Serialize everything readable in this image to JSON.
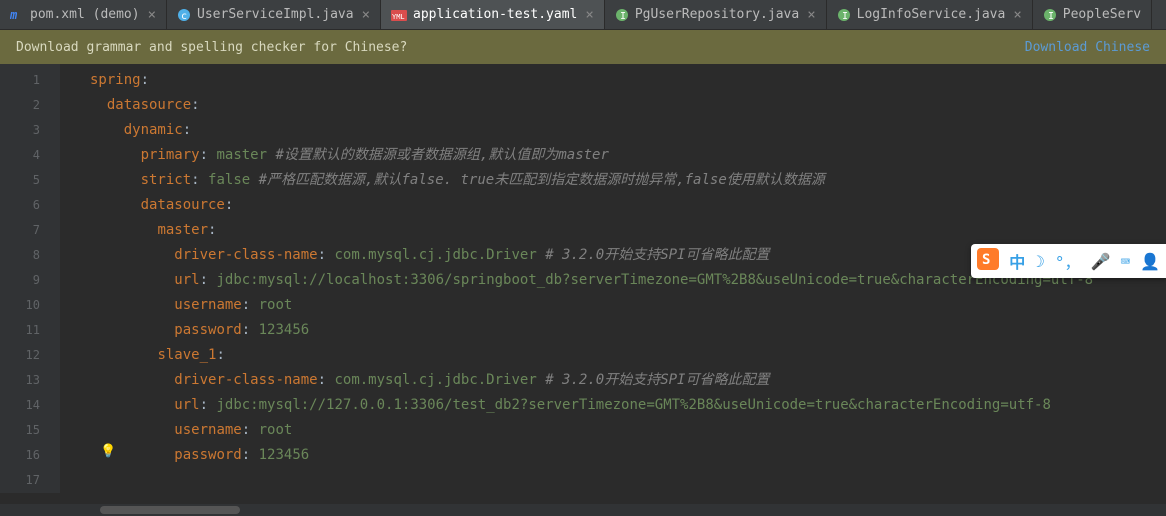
{
  "tabs": [
    {
      "label": "pom.xml (demo)",
      "icon": "maven-icon",
      "iconColor": "#4285f4"
    },
    {
      "label": "UserServiceImpl.java",
      "icon": "java-class-icon",
      "iconColor": "#4fb0e8"
    },
    {
      "label": "application-test.yaml",
      "icon": "yaml-icon",
      "iconColor": "#d94d4d",
      "active": true
    },
    {
      "label": "PgUserRepository.java",
      "icon": "java-interface-icon",
      "iconColor": "#6bb36b"
    },
    {
      "label": "LogInfoService.java",
      "icon": "java-interface-icon",
      "iconColor": "#6bb36b"
    },
    {
      "label": "PeopleServ",
      "icon": "java-interface-icon",
      "iconColor": "#6bb36b"
    }
  ],
  "banner": {
    "message": "Download grammar and spelling checker for Chinese?",
    "action": "Download Chinese"
  },
  "gutter": {
    "start": 1,
    "end": 17
  },
  "code": {
    "lines": [
      {
        "indent": 0,
        "key": "spring",
        "val": "",
        "comment": ""
      },
      {
        "indent": 1,
        "key": "datasource",
        "val": "",
        "comment": ""
      },
      {
        "indent": 2,
        "key": "dynamic",
        "val": "",
        "comment": ""
      },
      {
        "indent": 3,
        "key": "primary",
        "val": "master",
        "comment": "#设置默认的数据源或者数据源组,默认值即为master"
      },
      {
        "indent": 3,
        "key": "strict",
        "val": "false",
        "comment": "#严格匹配数据源,默认false. true未匹配到指定数据源时抛异常,false使用默认数据源"
      },
      {
        "indent": 3,
        "key": "datasource",
        "val": "",
        "comment": ""
      },
      {
        "indent": 4,
        "key": "master",
        "val": "",
        "comment": ""
      },
      {
        "indent": 5,
        "key": "driver-class-name",
        "val": "com.mysql.cj.jdbc.Driver",
        "comment": "# 3.2.0开始支持SPI可省略此配置"
      },
      {
        "indent": 5,
        "key": "url",
        "val": "jdbc:mysql://localhost:3306/springboot_db?serverTimezone=GMT%2B8&useUnicode=true&characterEncoding=utf-8",
        "comment": ""
      },
      {
        "indent": 5,
        "key": "username",
        "val": "root",
        "comment": ""
      },
      {
        "indent": 5,
        "key": "password",
        "val": "123456",
        "comment": ""
      },
      {
        "indent": 4,
        "key": "slave_1",
        "val": "",
        "comment": ""
      },
      {
        "indent": 5,
        "key": "driver-class-name",
        "val": "com.mysql.cj.jdbc.Driver",
        "comment": "# 3.2.0开始支持SPI可省略此配置"
      },
      {
        "indent": 5,
        "key": "url",
        "val": "jdbc:mysql://127.0.0.1:3306/test_db2?serverTimezone=GMT%2B8&useUnicode=true&characterEncoding=utf-8",
        "comment": ""
      },
      {
        "indent": 5,
        "key": "username",
        "val": "root",
        "comment": ""
      },
      {
        "indent": 5,
        "key": "password",
        "val": "123456",
        "comment": ""
      },
      {
        "indent": 0,
        "key": "",
        "val": "",
        "comment": ""
      }
    ]
  },
  "ime": {
    "logoLetter": "S",
    "lang": "中"
  },
  "colors": {
    "sogouOrange": "#ff7b29",
    "imeBlue": "#37a0e6"
  }
}
